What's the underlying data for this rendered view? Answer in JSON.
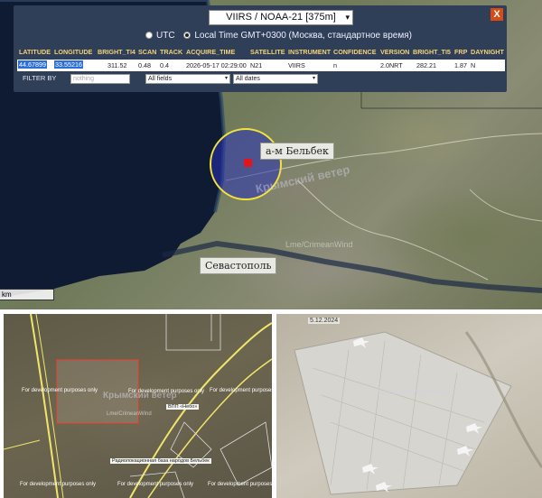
{
  "panel": {
    "sensor_select": "VIIRS / NOAA-21 [375m]",
    "close_label": "X",
    "timezone": {
      "utc_label": "UTC",
      "local_label": "Local Time GMT+0300 (Москва, стандартное время)",
      "selected": "local"
    },
    "table": {
      "headers": [
        "LATITUDE",
        "LONGITUDE",
        "BRIGHT_TI4",
        "SCAN",
        "TRACK",
        "ACQUIRE_TIME",
        "SATELLITE",
        "INSTRUMENT",
        "CONFIDENCE",
        "VERSION",
        "BRIGHT_TI5",
        "FRP",
        "DAYNIGHT"
      ],
      "row": [
        "44.67899",
        "33.55216",
        "311.52",
        "0.48",
        "0.4",
        "2026-05-17 02:29:00",
        "N21",
        "VIIRS",
        "n",
        "2.0NRT",
        "282.21",
        "1.87",
        "N"
      ]
    },
    "filter": {
      "label": "FILTER BY",
      "placeholder": "nothing",
      "field_select": "All fields",
      "date_select": "All dates"
    }
  },
  "map_top": {
    "label_airfield": "а-м Бельбек",
    "label_city": "Севастополь",
    "watermark": "Крымский ветер",
    "attribution": "Lme/CrimeanWind",
    "scale_label": "km",
    "colors": {
      "circle_border": "#f2e23a",
      "circle_fill": "#2832b4",
      "fire_pixel": "#e0161b",
      "panel_bg": "#2f3f58",
      "header_text": "#f3d27a"
    }
  },
  "pane_left": {
    "dev_text": "For development purposes only",
    "watermark": "Крымский ветер",
    "attribution": "Lme/CrimeanWind",
    "label_small": "ВПП «Небо»",
    "label_bottom": "Радиолокационная база народов Бельбек"
  },
  "pane_right": {
    "date": "5.12.2024",
    "watermark": "Крымский ветер"
  }
}
